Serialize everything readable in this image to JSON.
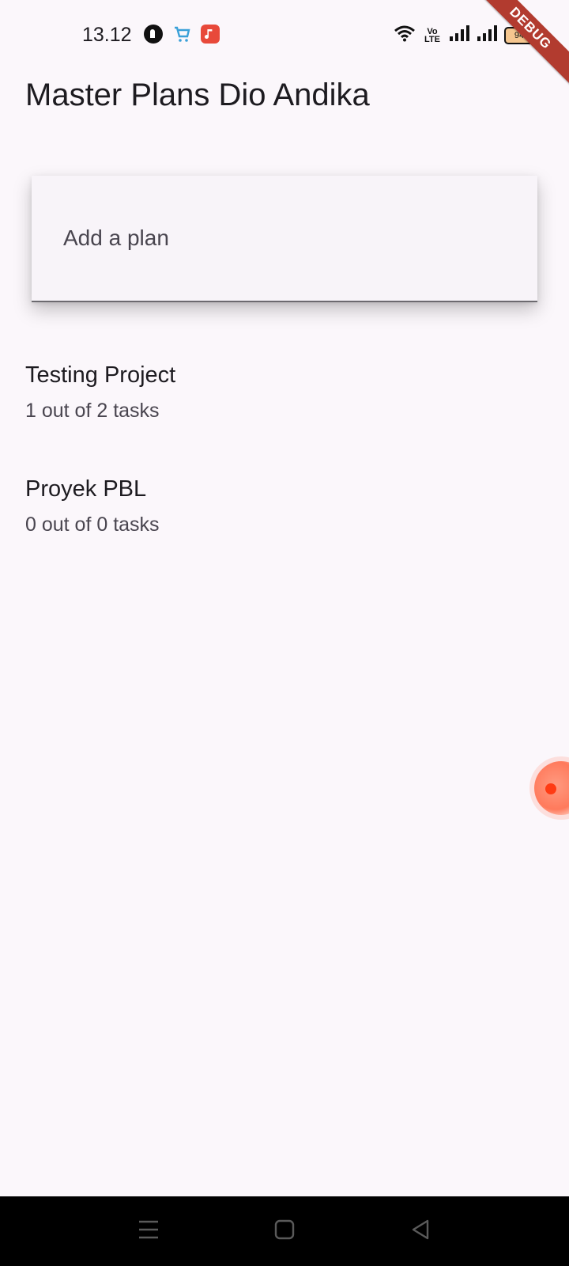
{
  "status_bar": {
    "time": "13.12",
    "volte": "Vo\nLTE",
    "battery": "94"
  },
  "debug_banner": "DEBUG",
  "app_bar": {
    "title": "Master Plans Dio Andika"
  },
  "plan_input": {
    "placeholder": "Add a plan",
    "value": ""
  },
  "plans": [
    {
      "name": "Testing Project",
      "summary": "1 out of 2 tasks"
    },
    {
      "name": "Proyek PBL",
      "summary": "0 out of 0 tasks"
    }
  ],
  "icons": {
    "notifications": [
      "app-notification-icon",
      "shopping-cart-icon",
      "music-icon"
    ],
    "system": [
      "wifi-icon",
      "volte-icon",
      "signal-icon",
      "signal-icon",
      "battery-icon"
    ],
    "nav": [
      "menu-icon",
      "home-icon",
      "back-icon"
    ]
  }
}
